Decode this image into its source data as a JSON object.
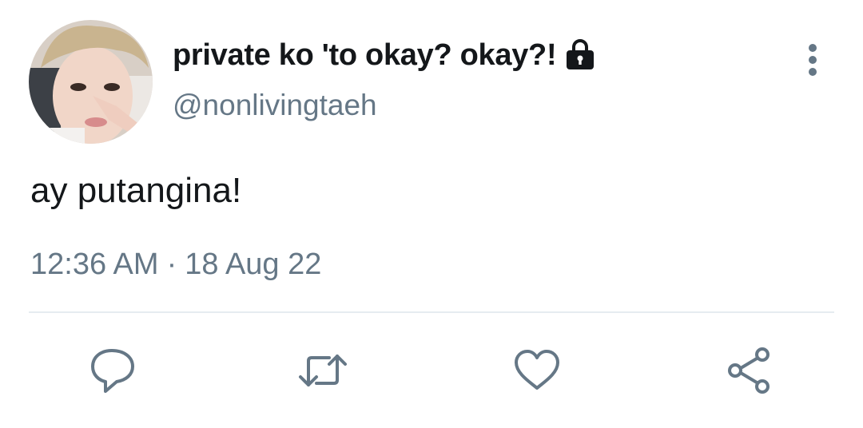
{
  "tweet": {
    "display_name": "private ko 'to okay? okay?!",
    "handle": "@nonlivingtaeh",
    "text": "ay putangina!",
    "time": "12:36 AM",
    "separator": "·",
    "date": "18 Aug 22"
  },
  "icons": {
    "lock": "lock-icon",
    "more": "more-vertical-icon",
    "reply": "reply-icon",
    "retweet": "retweet-icon",
    "like": "heart-icon",
    "share": "share-icon"
  },
  "colors": {
    "text_primary": "#14171a",
    "text_secondary": "#657786",
    "divider": "#e6ecf0"
  }
}
